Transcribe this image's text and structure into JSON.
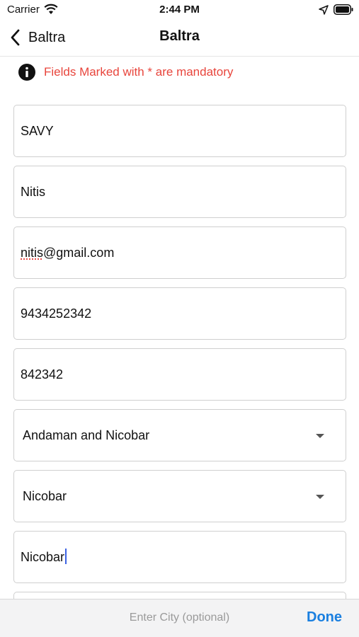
{
  "status_bar": {
    "carrier": "Carrier",
    "time": "2:44 PM"
  },
  "nav": {
    "back_label": "Baltra",
    "title": "Baltra"
  },
  "notice": {
    "message": "Fields Marked with * are mandatory"
  },
  "fields": {
    "name": "SAVY",
    "last_name": "Nitis",
    "email_underlined": "nitis",
    "email_rest": "@gmail.com",
    "phone": "9434252342",
    "pincode": "842342",
    "state": "Andaman and Nicobar",
    "district": "Nicobar",
    "city_area": "Nicobar"
  },
  "accessory": {
    "placeholder": "Enter City (optional)",
    "done_label": "Done"
  },
  "colors": {
    "accent": "#1a7fe0",
    "error": "#e8453c",
    "cursor": "#3b62e3"
  }
}
